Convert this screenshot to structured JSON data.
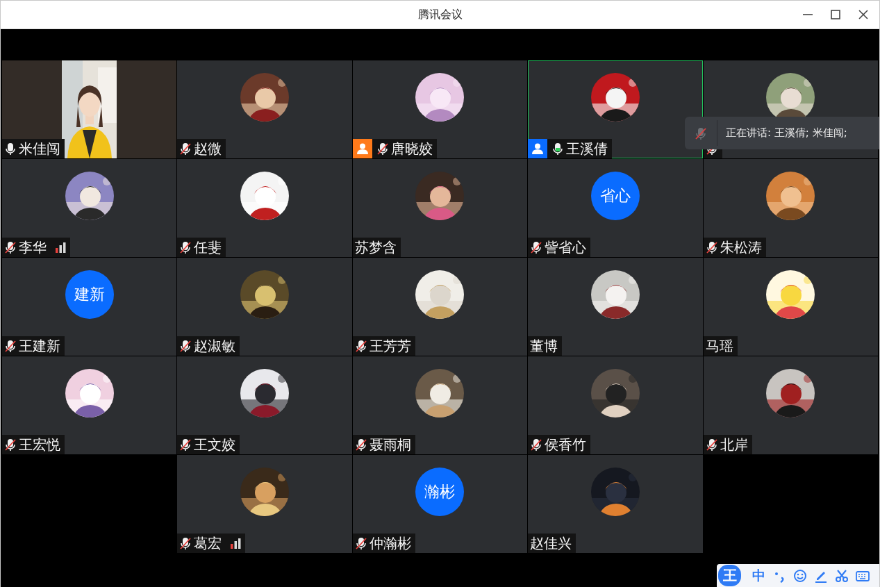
{
  "window": {
    "title": "腾讯会议"
  },
  "participants": [
    {
      "name": "米佳闯",
      "mic": {
        "muted": false,
        "talking": false
      },
      "avatar": {
        "kind": "video"
      },
      "highlighted": false,
      "weak_signal": false
    },
    {
      "name": "赵微",
      "mic": {
        "muted": true,
        "talking": false
      },
      "highlighted": false,
      "weak_signal": false
    },
    {
      "name": "唐晓姣",
      "mic": {
        "muted": true,
        "talking": false
      },
      "badge": {
        "color": "#ff7a1a"
      },
      "highlighted": false,
      "weak_signal": false
    },
    {
      "name": "王溪倩",
      "mic": {
        "muted": false,
        "talking": true
      },
      "badge": {
        "color": "#0a6cff"
      },
      "highlighted": true,
      "weak_signal": false
    },
    {
      "mic": {
        "muted": true,
        "talking": false
      },
      "highlighted": false,
      "weak_signal": false
    },
    {
      "name": "李华",
      "mic": {
        "muted": true,
        "talking": false
      },
      "highlighted": false,
      "weak_signal": true
    },
    {
      "name": "任斐",
      "mic": {
        "muted": true,
        "talking": false
      },
      "highlighted": false,
      "weak_signal": false
    },
    {
      "name": "苏梦含",
      "highlighted": false,
      "weak_signal": false
    },
    {
      "name": "訾省心",
      "mic": {
        "muted": true,
        "talking": false
      },
      "avatar": {
        "kind": "initials",
        "text": "省心"
      },
      "highlighted": false,
      "weak_signal": false
    },
    {
      "name": "朱松涛",
      "mic": {
        "muted": true,
        "talking": false
      },
      "highlighted": false,
      "weak_signal": false
    },
    {
      "name": "王建新",
      "mic": {
        "muted": true,
        "talking": false
      },
      "avatar": {
        "kind": "initials",
        "text": "建新"
      },
      "highlighted": false,
      "weak_signal": false
    },
    {
      "name": "赵淑敏",
      "mic": {
        "muted": true,
        "talking": false
      },
      "highlighted": false,
      "weak_signal": false
    },
    {
      "name": "王芳芳",
      "mic": {
        "muted": true,
        "talking": false
      },
      "highlighted": false,
      "weak_signal": false
    },
    {
      "name": "董博",
      "highlighted": false,
      "weak_signal": false
    },
    {
      "name": "马瑶",
      "highlighted": false,
      "weak_signal": false
    },
    {
      "name": "王宏悦",
      "mic": {
        "muted": true,
        "talking": false
      },
      "highlighted": false,
      "weak_signal": false
    },
    {
      "name": "王文姣",
      "mic": {
        "muted": true,
        "talking": false
      },
      "highlighted": false,
      "weak_signal": false
    },
    {
      "name": "聂雨桐",
      "mic": {
        "muted": true,
        "talking": false
      },
      "highlighted": false,
      "weak_signal": false
    },
    {
      "name": "侯香竹",
      "mic": {
        "muted": true,
        "talking": false
      },
      "highlighted": false,
      "weak_signal": false
    },
    {
      "name": "北岸",
      "mic": {
        "muted": true,
        "talking": false
      },
      "highlighted": false,
      "weak_signal": false
    },
    {
      "name": "葛宏",
      "mic": {
        "muted": true,
        "talking": false
      },
      "highlighted": false,
      "weak_signal": true
    },
    {
      "name": "仲瀚彬",
      "mic": {
        "muted": true,
        "talking": false
      },
      "avatar": {
        "kind": "initials",
        "text": "瀚彬"
      },
      "highlighted": false,
      "weak_signal": false
    },
    {
      "name": "赵佳兴",
      "highlighted": false,
      "weak_signal": false
    }
  ],
  "speaking_notice": {
    "text": "正在讲话: 王溪倩; 米佳闯;"
  },
  "ime_toolbar": {
    "logo": "王",
    "mode": "中"
  }
}
